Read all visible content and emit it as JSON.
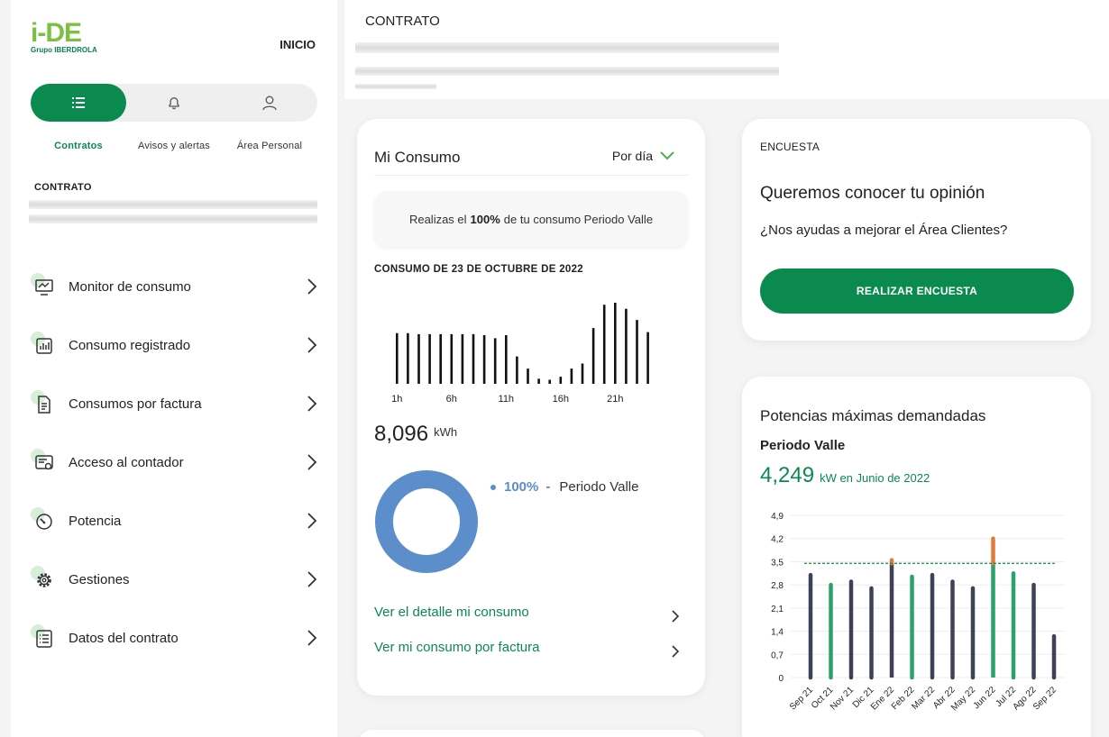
{
  "sidebar": {
    "logo": {
      "main": "i-DE",
      "sub": "Grupo IBERDROLA"
    },
    "inicio": "INICIO",
    "tabs": [
      {
        "label": "Contratos",
        "icon": "list-icon",
        "active": true
      },
      {
        "label": "Avisos y alertas",
        "icon": "bell-icon",
        "active": false
      },
      {
        "label": "Área Personal",
        "icon": "user-icon",
        "active": false
      }
    ],
    "contrato_heading": "CONTRATO",
    "menu": [
      {
        "label": "Monitor de consumo",
        "icon": "monitor-icon"
      },
      {
        "label": "Consumo registrado",
        "icon": "bar-chart-icon"
      },
      {
        "label": "Consumos por factura",
        "icon": "invoice-icon"
      },
      {
        "label": "Acceso al contador",
        "icon": "meter-icon"
      },
      {
        "label": "Potencia",
        "icon": "gauge-icon"
      },
      {
        "label": "Gestiones",
        "icon": "gear-icon"
      },
      {
        "label": "Datos del contrato",
        "icon": "list-doc-icon"
      }
    ]
  },
  "header": {
    "title": "CONTRATO"
  },
  "consumo": {
    "title": "Mi Consumo",
    "period_select": "Por día",
    "summary_pre": "Realizas el",
    "summary_bold": "100%",
    "summary_post": "de tu consumo Periodo Valle",
    "date_heading": "CONSUMO DE 23 DE OCTUBRE DE 2022",
    "total_value": "8,096",
    "total_unit": "kWh",
    "legend_pct": "100%",
    "legend_sep": "-",
    "legend_label": "Periodo Valle",
    "link_detail": "Ver el detalle mi consumo",
    "link_factura": "Ver mi consumo por factura",
    "color_donut": "#5b8ecb"
  },
  "encuesta": {
    "tag": "ENCUESTA",
    "question": "Queremos conocer tu opinión",
    "subtitle": "¿Nos ayudas a mejorar el Área Clientes?",
    "button": "REALIZAR ENCUESTA"
  },
  "potencias": {
    "title": "Potencias máximas demandadas",
    "period": "Periodo Valle",
    "value": "4,249",
    "value_sub": "kW en Junio de 2022"
  },
  "chart_data": [
    {
      "type": "bar",
      "title": "CONSUMO DE 23 DE OCTUBRE DE 2022",
      "categories": [
        "1h",
        "2h",
        "3h",
        "4h",
        "5h",
        "6h",
        "7h",
        "8h",
        "9h",
        "10h",
        "11h",
        "12h",
        "13h",
        "14h",
        "15h",
        "16h",
        "17h",
        "18h",
        "19h",
        "20h",
        "21h",
        "22h",
        "23h",
        "24h"
      ],
      "tick_labels": [
        "1h",
        "6h",
        "11h",
        "16h",
        "21h"
      ],
      "values": [
        0.5,
        0.5,
        0.49,
        0.49,
        0.49,
        0.49,
        0.49,
        0.49,
        0.48,
        0.45,
        0.48,
        0.27,
        0.15,
        0.05,
        0.04,
        0.07,
        0.15,
        0.2,
        0.55,
        0.78,
        0.8,
        0.74,
        0.63,
        0.51
      ],
      "color": "#111111",
      "grid": false
    },
    {
      "type": "bar",
      "title": "Potencias máximas demandadas",
      "categories": [
        "Sep 21",
        "Oct 21",
        "Nov 21",
        "Dic 21",
        "Ene 22",
        "Feb 22",
        "Mar 22",
        "Abr 22",
        "May 22",
        "Jun 22",
        "Jul 22",
        "Ago 22",
        "Sep 22"
      ],
      "values": [
        3.1,
        2.8,
        2.9,
        2.7,
        3.55,
        3.05,
        3.1,
        2.9,
        2.7,
        4.2,
        3.15,
        2.8,
        1.25
      ],
      "bar_colors": [
        "#3e4257",
        "#2aa36b",
        "#3e4257",
        "#3e4257",
        "#3e4257",
        "#2aa36b",
        "#3e4257",
        "#3e4257",
        "#3e4257",
        "#2aa36b",
        "#2aa36b",
        "#3e4257",
        "#3e4257"
      ],
      "contracted_power": 3.45,
      "exceed_color": "#e07b39",
      "threshold_color": "#0b8a4f",
      "yticks": [
        "4,9",
        "4,2",
        "3,5",
        "2,8",
        "2,1",
        "1,4",
        "0,7",
        "0"
      ],
      "ylim": [
        0,
        4.9
      ],
      "grid": true
    }
  ]
}
